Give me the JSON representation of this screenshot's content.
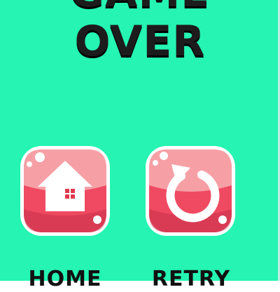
{
  "screen": {
    "title": "GAME OVER",
    "background_color": "#25f4b2"
  },
  "buttons": {
    "home": {
      "label": "HOME",
      "icon": "home-icon"
    },
    "retry": {
      "label": "RETRY",
      "icon": "retry-icon"
    }
  },
  "colors": {
    "button_face": "#ef4a62",
    "button_highlight": "#f6a0a6",
    "button_shadow": "#c92f49",
    "button_border": "#ffffff",
    "icon": "#ffffff",
    "title": "#1c1c1c"
  }
}
